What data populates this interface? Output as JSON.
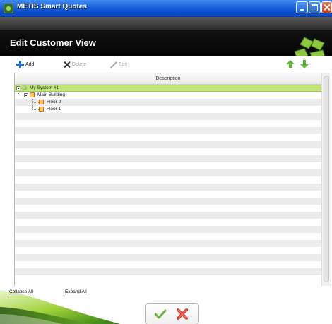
{
  "window": {
    "title": "METIS Smart Quotes"
  },
  "header": {
    "title": "Edit Customer View"
  },
  "toolbar": {
    "add_label": "Add",
    "delete_label": "Delete",
    "edit_label": "Edit"
  },
  "grid": {
    "column_header": "Description",
    "tree": [
      {
        "label": "My System #1",
        "level": 0,
        "selected": true
      },
      {
        "label": "Main Building",
        "level": 1
      },
      {
        "label": "Floor 2",
        "level": 2
      },
      {
        "label": "Floor 1",
        "level": 2
      }
    ]
  },
  "footer": {
    "collapse_all": "Collapse All",
    "expand_all": "Expand All"
  },
  "colors": {
    "selected_row": "#bfe67a",
    "titlebar": "#1f67de",
    "header_band": "#111111",
    "ok_green": "#6cb33e",
    "cancel_red": "#d23a2e"
  },
  "icons": [
    "app-icon",
    "plus-icon",
    "x-icon",
    "pencil-icon",
    "arrow-up-icon",
    "arrow-down-icon",
    "checkmark-icon",
    "cross-icon"
  ]
}
